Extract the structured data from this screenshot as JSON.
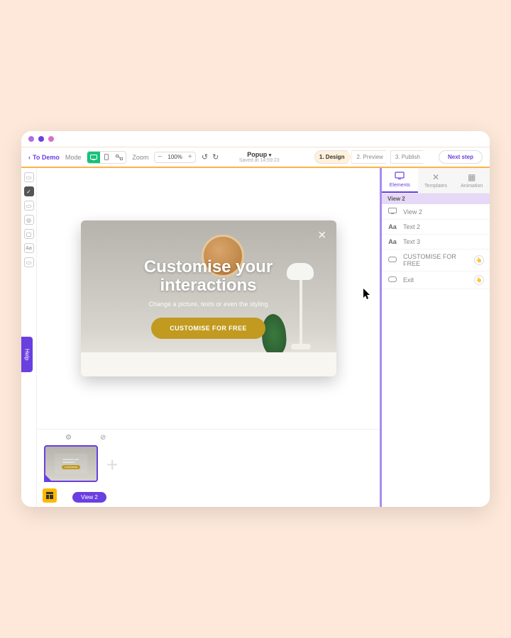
{
  "toolbar": {
    "back_label": "To Demo",
    "mode_label": "Mode",
    "zoom_label": "Zoom",
    "zoom_value": "100%",
    "doc_title": "Popup",
    "saved_text": "Saved at 14:59:23",
    "steps": {
      "design": "1. Design",
      "preview": "2. Preview",
      "publish": "3. Publish"
    },
    "next_step": "Next step"
  },
  "popup": {
    "title_line1": "Customise your",
    "title_line2": "interactions",
    "subtitle": "Change a picture, texts or even the styling",
    "cta": "CUSTOMISE FOR FREE"
  },
  "bottom": {
    "view_label": "View 2"
  },
  "panel": {
    "tabs": {
      "elements": "Elements",
      "templates": "Templates",
      "animation": "Animation"
    },
    "header": "View 2",
    "layers": [
      {
        "icon": "desktop",
        "name": "View 2"
      },
      {
        "icon": "Aa",
        "name": "Text 2"
      },
      {
        "icon": "Aa",
        "name": "Text 3"
      },
      {
        "icon": "button",
        "name": "CUSTOMISE FOR FREE",
        "action": true
      },
      {
        "icon": "button",
        "name": "Exit",
        "action": true
      }
    ]
  },
  "help": "Help"
}
